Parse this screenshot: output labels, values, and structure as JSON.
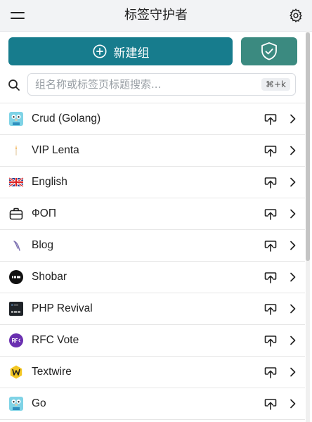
{
  "header": {
    "title": "标签守护者",
    "menu_icon": "menu-icon",
    "settings_icon": "gear-icon"
  },
  "actions": {
    "new_group_label": "新建组",
    "new_group_icon": "plus-circle-icon",
    "shield_icon": "shield-check-icon"
  },
  "colors": {
    "primary": "#177c8d",
    "secondary": "#3b8a80",
    "header_bg": "#f2f3f5"
  },
  "search": {
    "placeholder": "组名称或标签页标题搜索...",
    "shortcut": "⌘+k",
    "icon": "search-icon"
  },
  "groups": [
    {
      "name": "Crud (Golang)",
      "icon": "gopher-icon"
    },
    {
      "name": "VIP Lenta",
      "icon": "lenta-icon"
    },
    {
      "name": "English",
      "icon": "uk-flag-icon"
    },
    {
      "name": "ФОП",
      "icon": "briefcase-icon"
    },
    {
      "name": "Blog",
      "icon": "quill-icon"
    },
    {
      "name": "Shobar",
      "icon": "shobar-icon"
    },
    {
      "name": "PHP Revival",
      "icon": "php-icon"
    },
    {
      "name": "RFC Vote",
      "icon": "rfc-icon"
    },
    {
      "name": "Textwire",
      "icon": "textwire-icon"
    },
    {
      "name": "Go",
      "icon": "gopher-icon"
    }
  ]
}
